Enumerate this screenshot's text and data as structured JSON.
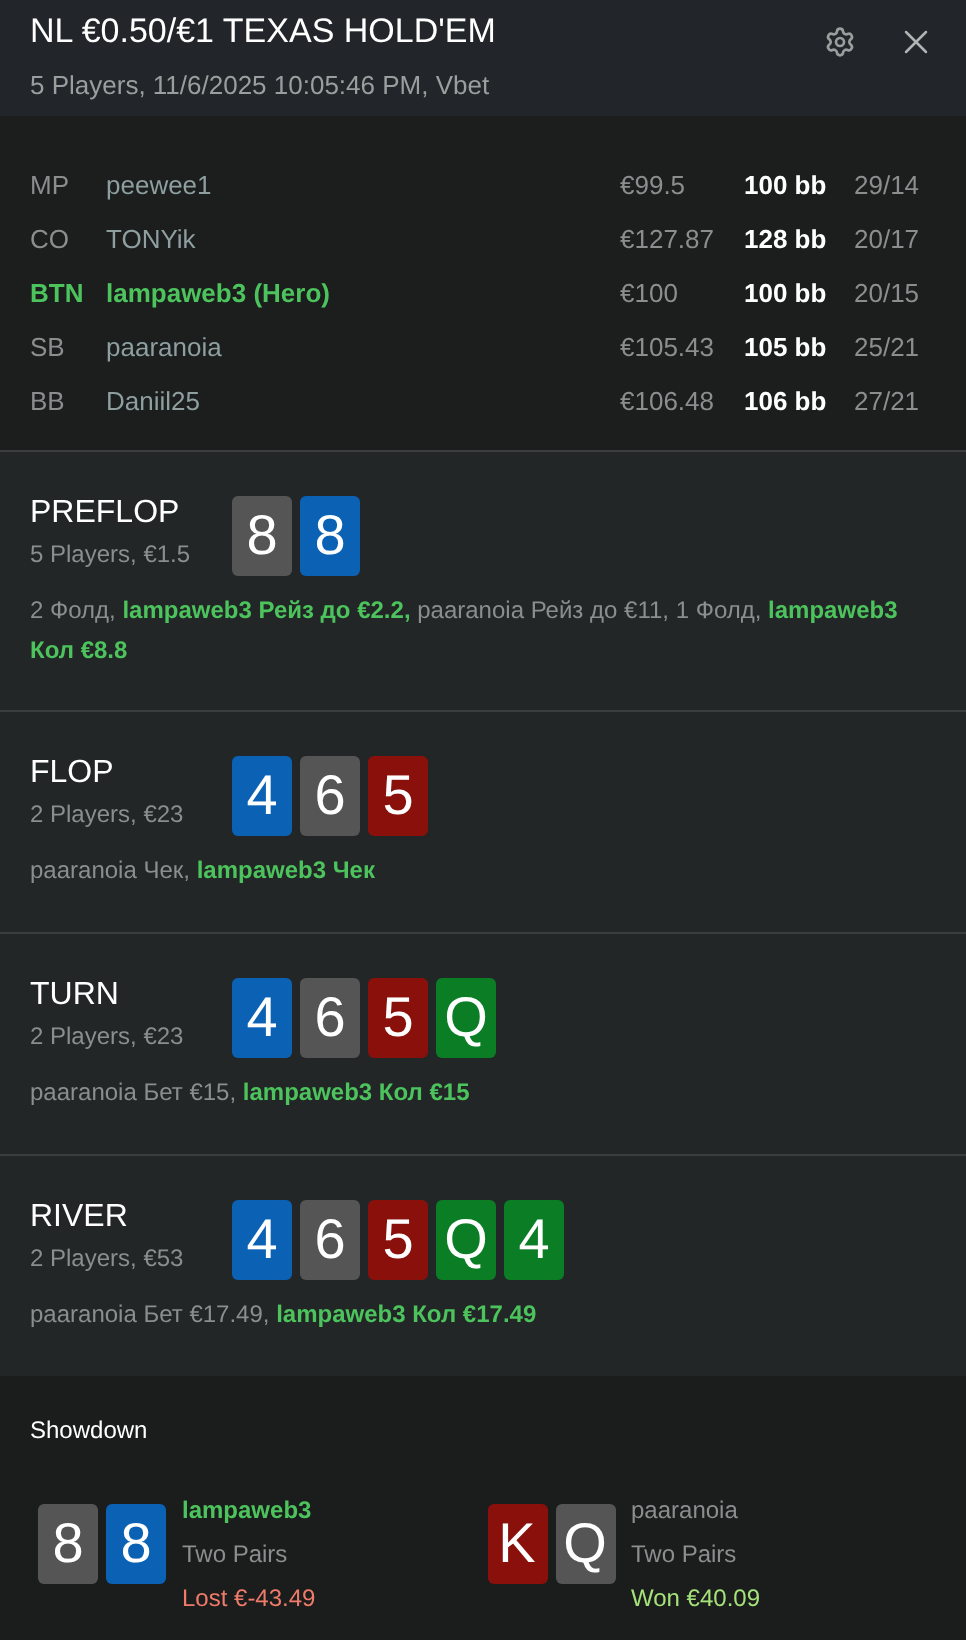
{
  "header": {
    "title": "NL €0.50/€1 TEXAS HOLD'EM",
    "subtitle": "5 Players, 11/6/2025 10:05:46 PM, Vbet"
  },
  "players": [
    {
      "position": "MP",
      "name": "peewee1",
      "stack": "€99.5",
      "bb": "100 bb",
      "stats": "29/14",
      "hero": false
    },
    {
      "position": "CO",
      "name": "TONYik",
      "stack": "€127.87",
      "bb": "128 bb",
      "stats": "20/17",
      "hero": false
    },
    {
      "position": "BTN",
      "name": "lampaweb3 (Hero)",
      "stack": "€100",
      "bb": "100 bb",
      "stats": "20/15",
      "hero": true
    },
    {
      "position": "SB",
      "name": "paaranoia",
      "stack": "€105.43",
      "bb": "105 bb",
      "stats": "25/21",
      "hero": false
    },
    {
      "position": "BB",
      "name": "Daniil25",
      "stack": "€106.48",
      "bb": "106 bb",
      "stats": "27/21",
      "hero": false
    }
  ],
  "streets": [
    {
      "name": "PREFLOP",
      "info": "5 Players, €1.5",
      "cards": [
        {
          "rank": "8",
          "color": "#555555"
        },
        {
          "rank": "8",
          "color": "#0b62b5"
        }
      ],
      "actions": [
        {
          "text": "2 Фолд, ",
          "hero": false
        },
        {
          "text": "lampaweb3 Рейз до €2.2, ",
          "hero": true
        },
        {
          "text": "paaranoia Рейз до €11, 1 Фолд, ",
          "hero": false
        },
        {
          "text": "lampaweb3 Кол €8.8",
          "hero": true
        }
      ]
    },
    {
      "name": "FLOP",
      "info": "2 Players, €23",
      "cards": [
        {
          "rank": "4",
          "color": "#0b62b5"
        },
        {
          "rank": "6",
          "color": "#555555"
        },
        {
          "rank": "5",
          "color": "#8a100b"
        }
      ],
      "actions": [
        {
          "text": "paaranoia Чек, ",
          "hero": false
        },
        {
          "text": "lampaweb3 Чек",
          "hero": true
        }
      ]
    },
    {
      "name": "TURN",
      "info": "2 Players, €23",
      "cards": [
        {
          "rank": "4",
          "color": "#0b62b5"
        },
        {
          "rank": "6",
          "color": "#555555"
        },
        {
          "rank": "5",
          "color": "#8a100b"
        },
        {
          "rank": "Q",
          "color": "#0a7d25"
        }
      ],
      "actions": [
        {
          "text": "paaranoia Бет €15, ",
          "hero": false
        },
        {
          "text": "lampaweb3 Кол €15",
          "hero": true
        }
      ]
    },
    {
      "name": "RIVER",
      "info": "2 Players, €53",
      "cards": [
        {
          "rank": "4",
          "color": "#0b62b5"
        },
        {
          "rank": "6",
          "color": "#555555"
        },
        {
          "rank": "5",
          "color": "#8a100b"
        },
        {
          "rank": "Q",
          "color": "#0a7d25"
        },
        {
          "rank": "4",
          "color": "#0a7d25"
        }
      ],
      "actions": [
        {
          "text": "paaranoia Бет €17.49, ",
          "hero": false
        },
        {
          "text": "lampaweb3 Кол €17.49",
          "hero": true
        }
      ]
    }
  ],
  "showdown": {
    "title": "Showdown",
    "hands": [
      {
        "cards": [
          {
            "rank": "8",
            "color": "#555555"
          },
          {
            "rank": "8",
            "color": "#0b62b5"
          }
        ],
        "player": "lampaweb3",
        "hero": true,
        "hand": "Two Pairs",
        "result": "Lost €-43.49",
        "kind": "lost"
      },
      {
        "cards": [
          {
            "rank": "K",
            "color": "#8a100b"
          },
          {
            "rank": "Q",
            "color": "#555555"
          }
        ],
        "player": "paaranoia",
        "hero": false,
        "hand": "Two Pairs",
        "result": "Won €40.09",
        "kind": "won"
      }
    ]
  }
}
